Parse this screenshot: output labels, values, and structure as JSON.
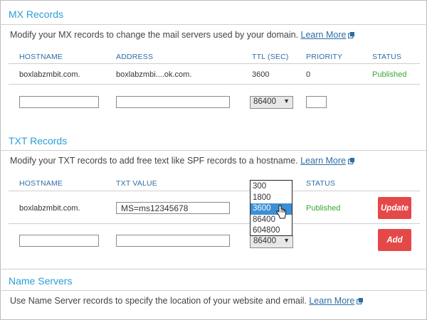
{
  "mx": {
    "title": "MX Records",
    "description": "Modify your MX records to change the mail servers used by your domain.",
    "learn_more": "Learn More",
    "headers": {
      "hostname": "HOSTNAME",
      "address": "ADDRESS",
      "ttl": "TTL (SEC)",
      "priority": "PRIORITY",
      "status": "STATUS"
    },
    "row": {
      "hostname": "boxlabzmbit.com.",
      "address": "boxlabzmbi....ok.com.",
      "ttl": "3600",
      "priority": "0",
      "status": "Published"
    },
    "new_ttl": "86400"
  },
  "txt": {
    "title": "TXT Records",
    "description": "Modify your TXT records to add free text like SPF records to a hostname.",
    "learn_more": "Learn More",
    "headers": {
      "hostname": "HOSTNAME",
      "txt_value": "TXT VALUE",
      "status": "STATUS"
    },
    "row": {
      "hostname": "boxlabzmbit.com.",
      "txt_value": "MS=ms12345678",
      "status": "Published"
    },
    "update_label": "Update",
    "add_label": "Add",
    "new_ttl": "86400"
  },
  "ttl_dropdown": {
    "options": [
      "300",
      "1800",
      "3600",
      "86400",
      "604800"
    ],
    "highlighted": "3600"
  },
  "ns": {
    "title": "Name Servers",
    "description": "Use Name Server records to specify the location of your website and email.",
    "learn_more": "Learn More"
  },
  "colors": {
    "accent": "#2a9fd6",
    "link": "#2e6da4",
    "published": "#3aa635",
    "button": "#e54848",
    "highlight": "#3d8fd6"
  }
}
